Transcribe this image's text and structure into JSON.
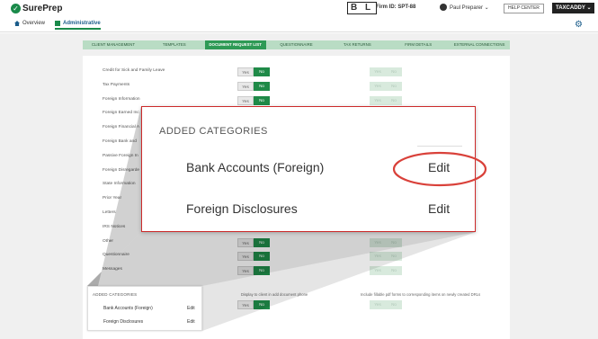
{
  "header": {
    "logo_text": "SurePrep",
    "logo_mark": "✓",
    "badge": "B L",
    "firm_id": "Firm ID: SPT-88",
    "user_name": "Paul Preparer ⌄",
    "help_label": "HELP CENTER",
    "taxcaddy_label": "TAXCADDY ⌄"
  },
  "subnav": {
    "overview": "Overview",
    "administrative": "Administrative",
    "gear_icon": "⚙"
  },
  "tabs": [
    {
      "label": "CLIENT MANAGEMENT",
      "active": false
    },
    {
      "label": "TEMPLATES",
      "active": false
    },
    {
      "label": "DOCUMENT REQUEST LIST",
      "active": true
    },
    {
      "label": "QUESTIONNAIRE",
      "active": false
    },
    {
      "label": "TAX RETURNS",
      "active": false
    },
    {
      "label": "FIRM DETAILS",
      "active": false
    },
    {
      "label": "EXTERNAL CONNECTIONS",
      "active": false
    }
  ],
  "rows": [
    {
      "label": "Credit for Sick and Family Leave",
      "toggle": "visible"
    },
    {
      "label": "Tax Payments",
      "toggle": "visible"
    },
    {
      "label": "Foreign Information",
      "toggle": "visible"
    },
    {
      "label": "Foreign Earned Inc",
      "toggle": "hidden"
    },
    {
      "label": "Foreign Financial A",
      "toggle": "hidden"
    },
    {
      "label": "Foreign Bank and",
      "toggle": "hidden"
    },
    {
      "label": "Passive Foreign In",
      "toggle": "hidden"
    },
    {
      "label": "Foreign Disregarde",
      "toggle": "hidden"
    },
    {
      "label": "State Information",
      "toggle": "hidden"
    },
    {
      "label": "Prior Year",
      "toggle": "hidden"
    },
    {
      "label": "Letters",
      "toggle": "hidden"
    },
    {
      "label": "IRS Notices",
      "toggle": "hidden"
    },
    {
      "label": "Other",
      "toggle": "visible"
    },
    {
      "label": "Questionnaire",
      "toggle": "visible"
    },
    {
      "label": "Messages",
      "toggle": "visible"
    }
  ],
  "toggle": {
    "yes": "Yes",
    "no": "No"
  },
  "notes": {
    "display": "Display to client in add document phone",
    "fillable": "Include fillable pdf forms to corresponding items on newly created DRLs"
  },
  "small_panel": {
    "title": "ADDED CATEGORIES",
    "items": [
      {
        "label": "Bank Accounts (Foreign)",
        "action": "Edit"
      },
      {
        "label": "Foreign Disclosures",
        "action": "Edit"
      }
    ]
  },
  "zoom": {
    "title": "ADDED CATEGORIES",
    "items": [
      {
        "label": "Bank Accounts (Foreign)",
        "action": "Edit"
      },
      {
        "label": "Foreign Disclosures",
        "action": "Edit"
      }
    ],
    "highlight_color": "#d9413a"
  },
  "colors": {
    "brand_green": "#1f8a48",
    "tab_bg": "#b9dcc4",
    "accent_blue": "#1a5c8a"
  }
}
